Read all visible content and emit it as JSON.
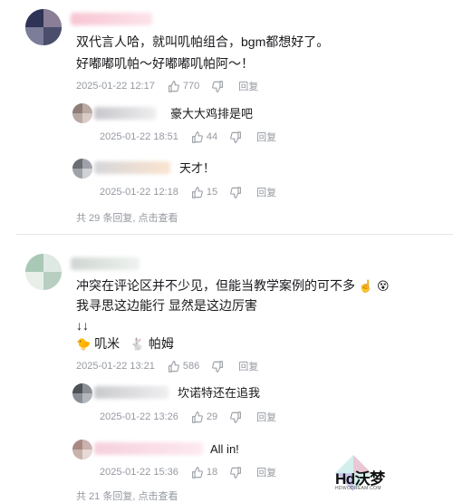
{
  "comments": [
    {
      "text_lines": [
        "双代言人哈，就叫叽帕组合，bgm都想好了。",
        "好嘟嘟叽帕～好嘟嘟叽帕阿～！"
      ],
      "time": "2025-01-22 12:17",
      "likes": "770",
      "reply_label": "回复",
      "replies": [
        {
          "text": "豪大大鸡排是吧",
          "time": "2025-01-22 18:51",
          "likes": "44",
          "reply_label": "回复"
        },
        {
          "text": "天才！",
          "time": "2025-01-22 12:18",
          "likes": "15",
          "reply_label": "回复"
        }
      ],
      "more": {
        "prefix": "共 29 条回复,",
        "link": "点击查看"
      }
    },
    {
      "text_lines": [
        "冲突在评论区并不少见，但能当教学案例的可不多",
        "我寻思这边能行 显然是这边厉害",
        "↓↓"
      ],
      "emoji_line": [
        {
          "emoji": "🐤",
          "label": "叽米"
        },
        {
          "emoji": "🐇",
          "label": "帕姆"
        }
      ],
      "line1_emojis": [
        "☝️",
        "😵"
      ],
      "time": "2025-01-22 13:21",
      "likes": "586",
      "reply_label": "回复",
      "replies": [
        {
          "text": "坎诺特还在追我",
          "time": "2025-01-22 13:26",
          "likes": "29",
          "reply_label": "回复"
        },
        {
          "text": "All in!",
          "time": "2025-01-22 15:36",
          "likes": "18",
          "reply_label": "回复"
        }
      ],
      "more": {
        "prefix": "共 21 条回复,",
        "link": "点击查看"
      }
    }
  ],
  "watermark": {
    "text": "Hd沃梦",
    "sub": "HDWODREAM.COM"
  },
  "colors": {
    "text": "#18191c",
    "meta": "#9499a0",
    "divider": "#e3e5e7"
  }
}
